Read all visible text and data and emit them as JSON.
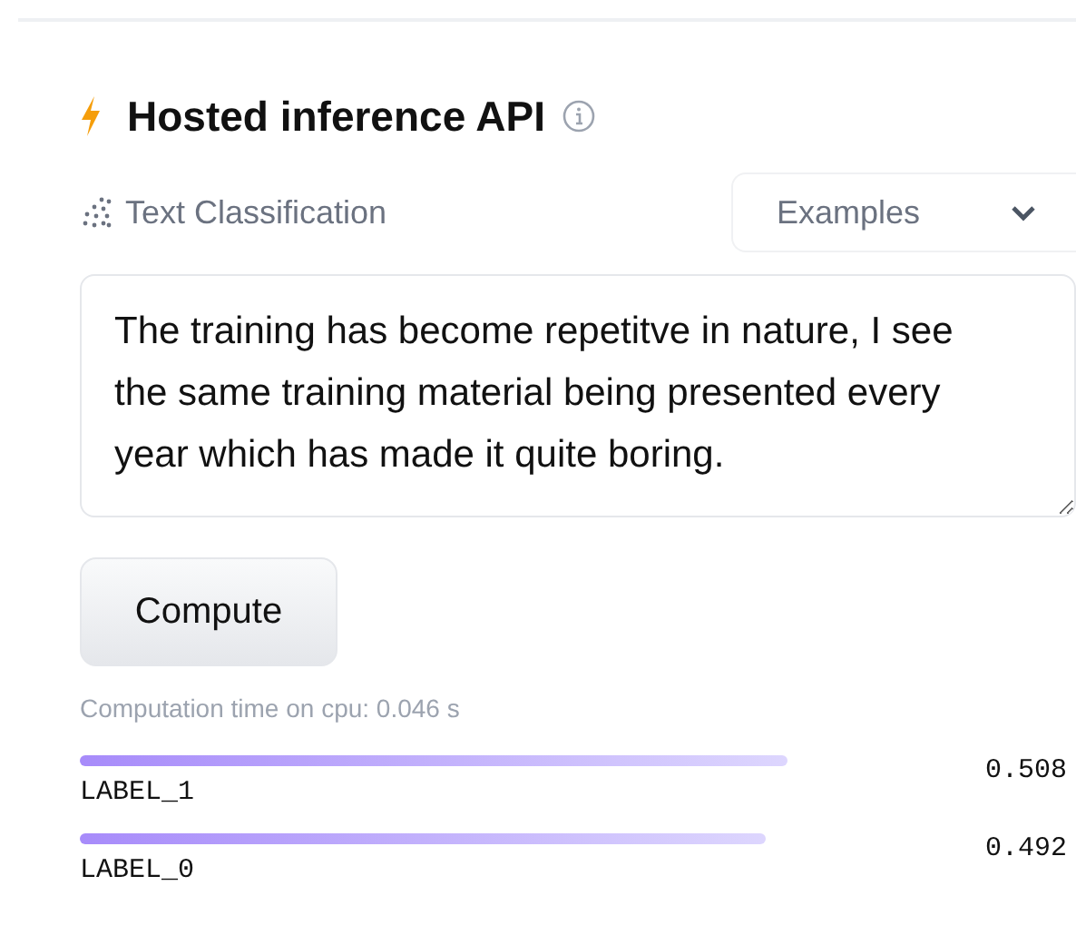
{
  "title": "Hosted inference API",
  "task": "Text Classification",
  "examples_dropdown": {
    "label": "Examples"
  },
  "input": {
    "value": "The training has become repetitve in nature, I see the same training material being presented every year which has made it quite boring."
  },
  "compute_button": "Compute",
  "computation_time": "Computation time on cpu: 0.046 s",
  "results": [
    {
      "label": "LABEL_1",
      "score": "0.508"
    },
    {
      "label": "LABEL_0",
      "score": "0.492"
    }
  ]
}
